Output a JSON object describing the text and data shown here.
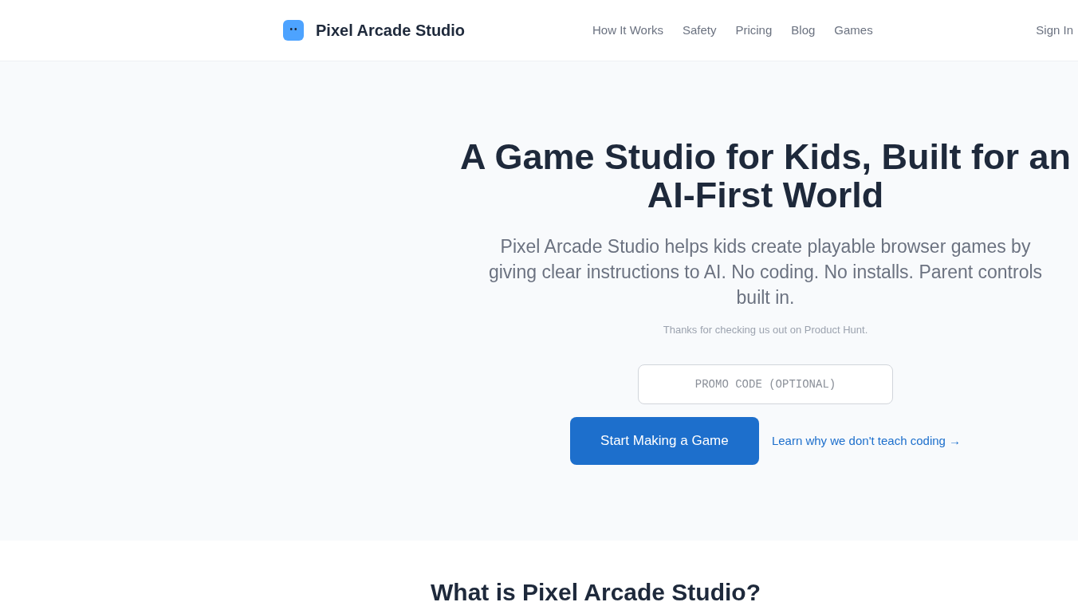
{
  "header": {
    "brand": "Pixel Arcade Studio",
    "nav": [
      "How It Works",
      "Safety",
      "Pricing",
      "Blog",
      "Games"
    ],
    "sign_in": "Sign In"
  },
  "hero": {
    "heading_lines": [
      "A Game Studio for Kids, Built for an",
      "AI-First World"
    ],
    "subtitle": "Pixel Arcade Studio helps kids create playable browser games by giving clear instructions to AI. No coding. No installs. Parent controls built in.",
    "note": "Thanks for checking us out on Product Hunt.",
    "promo_field": {
      "placeholder": "PROMO CODE (OPTIONAL)"
    },
    "primary_button": "Start Making a Game",
    "link": "Learn why we don't teach coding →"
  },
  "section": {
    "title": "What is Pixel Arcade Studio?"
  }
}
